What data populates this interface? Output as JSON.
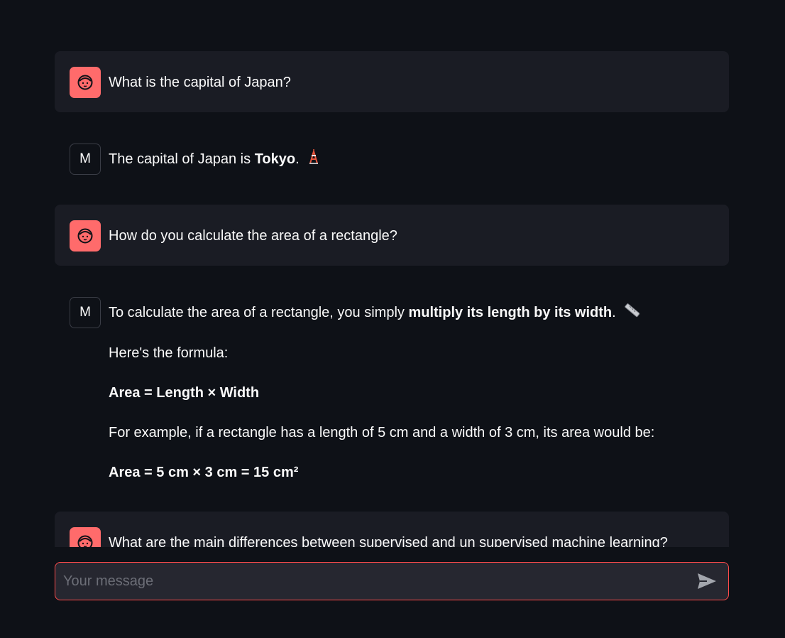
{
  "messages": [
    {
      "role": "user",
      "avatar_icon": "user-face-icon",
      "text": "What is the capital of Japan?"
    },
    {
      "role": "assistant",
      "avatar_label": "M",
      "text_pre": "The capital of Japan is ",
      "text_bold": "Tokyo",
      "text_post": ".",
      "emoji_icon": "tokyo-tower-icon"
    },
    {
      "role": "user",
      "avatar_icon": "user-face-icon",
      "text": "How do you calculate the area of a rectangle?"
    },
    {
      "role": "assistant",
      "avatar_label": "M",
      "line1_pre": "To calculate the area of a rectangle, you simply ",
      "line1_bold": "multiply its length by its width",
      "line1_post": ".",
      "line1_emoji_icon": "ruler-icon",
      "line2": "Here's the formula:",
      "line3_bold": "Area = Length × Width",
      "line4": "For example, if a rectangle has a length of 5 cm and a width of 3 cm, its area would be:",
      "line5_bold": "Area = 5 cm × 3 cm = 15 cm²"
    },
    {
      "role": "user",
      "avatar_icon": "user-face-icon",
      "text": "What are the main differences between supervised and un supervised machine learning?"
    }
  ],
  "input": {
    "placeholder": "Your message",
    "value": ""
  },
  "send_icon": "send-icon",
  "colors": {
    "background": "#0e1117",
    "user_bubble": "#1a1c24",
    "user_avatar": "#ff6b6b",
    "input_border": "#ff4b4b"
  }
}
